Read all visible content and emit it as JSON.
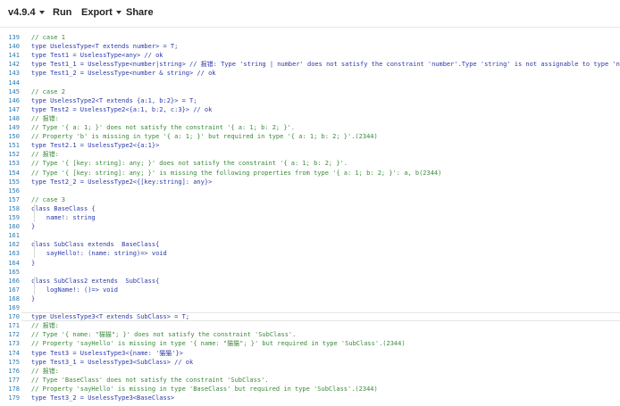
{
  "toolbar": {
    "version": "v4.9.4",
    "run": "Run",
    "export": "Export",
    "share": "Share"
  },
  "editor": {
    "lines": [
      {
        "n": "139",
        "t": "// case 1",
        "c": true
      },
      {
        "n": "140",
        "t": "type UselessType<T extends number> = T;"
      },
      {
        "n": "141",
        "t": "type Test1 = UselessType<any> // ok"
      },
      {
        "n": "142",
        "t": "type Test1_1 = UselessType<number|string> // 报错: Type 'string | number' does not satisfy the constraint 'number'.Type 'string' is not assignable to type 'number'"
      },
      {
        "n": "143",
        "t": "type Test1_2 = UselessType<number & string> // ok"
      },
      {
        "n": "144",
        "t": ""
      },
      {
        "n": "145",
        "t": "// case 2",
        "c": true
      },
      {
        "n": "146",
        "t": "type UselessType2<T extends {a:1, b:2}> = T;"
      },
      {
        "n": "147",
        "t": "type Test2 = UselessType2<{a:1, b:2, c:3}> // ok"
      },
      {
        "n": "148",
        "t": "// 报错:",
        "c": true
      },
      {
        "n": "149",
        "t": "// Type '{ a: 1; }' does not satisfy the constraint '{ a: 1; b: 2; }'.",
        "c": true
      },
      {
        "n": "150",
        "t": "// Property 'b' is missing in type '{ a: 1; }' but required in type '{ a: 1; b: 2; }'.(2344)",
        "c": true
      },
      {
        "n": "151",
        "t": "type Test2.1 = UselessType2<{a:1}>"
      },
      {
        "n": "152",
        "t": "// 报错:",
        "c": true
      },
      {
        "n": "153",
        "t": "// Type '{ [key: string]: any; }' does not satisfy the constraint '{ a: 1; b: 2; }'.",
        "c": true
      },
      {
        "n": "154",
        "t": "// Type '{ [key: string]: any; }' is missing the following properties from type '{ a: 1; b: 2; }': a, b(2344)",
        "c": true
      },
      {
        "n": "155",
        "t": "type Test2_2 = UselessType2<{[key:string]: any}>"
      },
      {
        "n": "156",
        "t": ""
      },
      {
        "n": "157",
        "t": "// case 3",
        "c": true
      },
      {
        "n": "158",
        "t": "class BaseClass {"
      },
      {
        "n": "159",
        "t": "    name!: string"
      },
      {
        "n": "160",
        "t": "}"
      },
      {
        "n": "161",
        "t": ""
      },
      {
        "n": "162",
        "t": "class SubClass extends  BaseClass{"
      },
      {
        "n": "163",
        "t": "    sayHello!: (name: string)=> void"
      },
      {
        "n": "164",
        "t": "}"
      },
      {
        "n": "165",
        "t": ""
      },
      {
        "n": "166",
        "t": "class SubClass2 extends  SubClass{"
      },
      {
        "n": "167",
        "t": "    logName!: ()=> void"
      },
      {
        "n": "168",
        "t": "}"
      },
      {
        "n": "169",
        "t": ""
      },
      {
        "n": "170",
        "t": "type UselessType3<T extends SubClass> = T;"
      },
      {
        "n": "171",
        "t": "// 报错:",
        "c": true
      },
      {
        "n": "172",
        "t": "// Type '{ name: \"猫猫\"; }' does not satisfy the constraint 'SubClass'.",
        "c": true
      },
      {
        "n": "173",
        "t": "// Property 'sayHello' is missing in type '{ name: \"猫猫\"; }' but required in type 'SubClass'.(2344)",
        "c": true
      },
      {
        "n": "174",
        "t": "type Test3 = UselessType3<{name: '猫猫'}>"
      },
      {
        "n": "175",
        "t": "type Test3_1 = UselessType3<SubClass> // ok"
      },
      {
        "n": "176",
        "t": "// 报错:",
        "c": true
      },
      {
        "n": "177",
        "t": "// Type 'BaseClass' does not satisfy the constraint 'SubClass'.",
        "c": true
      },
      {
        "n": "178",
        "t": "// Property 'sayHello' is missing in type 'BaseClass' but required in type 'SubClass'.(2344)",
        "c": true
      },
      {
        "n": "179",
        "t": "type Test3_2 = UselessType3<BaseClass>"
      }
    ]
  }
}
